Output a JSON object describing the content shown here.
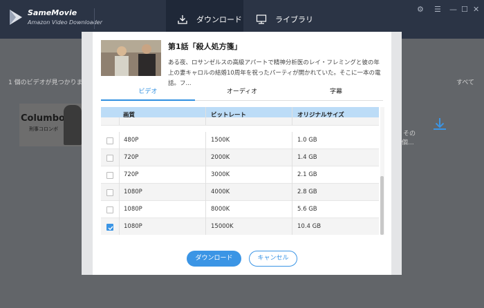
{
  "app": {
    "name": "SameMovie",
    "subtitle": "Amazon Video Downloader",
    "tabs": [
      {
        "label": "ダウンロード",
        "icon": "download-tab-icon",
        "active": true
      },
      {
        "label": "ライブラリ",
        "icon": "library-icon",
        "active": false
      }
    ],
    "window_controls": [
      "settings-icon",
      "menu-icon",
      "minimize-icon",
      "maximize-icon",
      "close-icon"
    ]
  },
  "background": {
    "found_text": "1 個のビデオが見つかりま",
    "sort_label": "すべて",
    "thumb_title": "Columbo",
    "thumb_sub": "刑事コロンボ",
    "fragment_1": "その",
    "fragment_2": "の個..."
  },
  "episode": {
    "title": "第1話「殺人処方箋」",
    "description": "ある夜、ロサンゼルスの高級アパートで精神分析医のレイ・フレミングと彼の年上の妻キャロルの結婚10周年を祝ったパーティが開かれていた。そこに一本の電話。フ..."
  },
  "tabs": [
    {
      "label": "ビデオ",
      "active": true
    },
    {
      "label": "オーディオ",
      "active": false
    },
    {
      "label": "字幕",
      "active": false
    }
  ],
  "table": {
    "headers": {
      "quality": "画質",
      "bitrate": "ビットレート",
      "size": "オリジナルサイズ"
    },
    "rows": [
      {
        "quality": "480P",
        "bitrate": "1500K",
        "size": "1.0 GB",
        "checked": false
      },
      {
        "quality": "720P",
        "bitrate": "2000K",
        "size": "1.4 GB",
        "checked": false
      },
      {
        "quality": "720P",
        "bitrate": "3000K",
        "size": "2.1 GB",
        "checked": false
      },
      {
        "quality": "1080P",
        "bitrate": "4000K",
        "size": "2.8 GB",
        "checked": false
      },
      {
        "quality": "1080P",
        "bitrate": "8000K",
        "size": "5.6 GB",
        "checked": false
      },
      {
        "quality": "1080P",
        "bitrate": "15000K",
        "size": "10.4 GB",
        "checked": true
      }
    ]
  },
  "buttons": {
    "download": "ダウンロード",
    "cancel": "キャンセル"
  },
  "colors": {
    "accent": "#3b95e5",
    "titlebar": "#2b3445",
    "header_row": "#bcdcf7"
  }
}
